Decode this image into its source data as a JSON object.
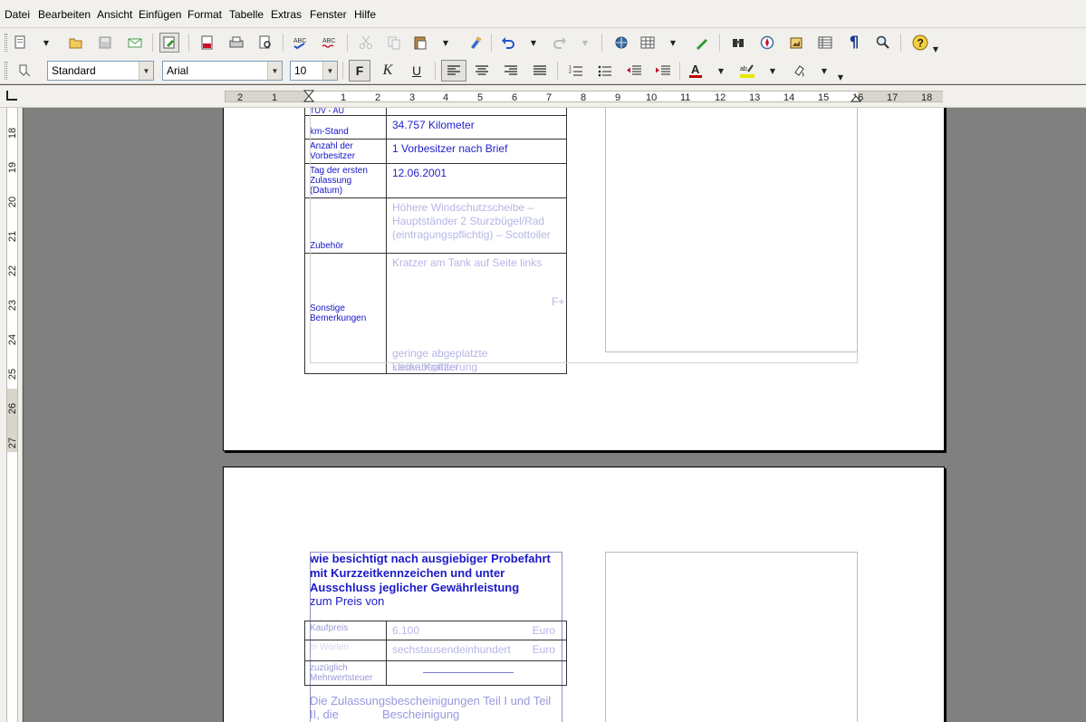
{
  "menu": {
    "items": [
      "Datei",
      "Bearbeiten",
      "Ansicht",
      "Einfügen",
      "Format",
      "Tabelle",
      "Extras",
      "Fenster",
      "Hilfe"
    ]
  },
  "toolbar1": {
    "icons": [
      "new-document-icon",
      "open-icon",
      "save-icon",
      "email-icon",
      "edit-mode-icon",
      "export-pdf-icon",
      "print-icon",
      "page-preview-icon",
      "spellcheck-icon",
      "autospellcheck-icon",
      "cut-icon",
      "copy-icon",
      "paste-icon",
      "format-paintbrush-icon",
      "undo-icon",
      "redo-icon",
      "hyperlink-icon",
      "table-icon",
      "draw-functions-icon",
      "find-replace-icon",
      "navigator-icon",
      "gallery-icon",
      "data-sources-icon",
      "formatting-marks-icon",
      "zoom-icon",
      "help-icon"
    ]
  },
  "toolbar2": {
    "paragraph_style": "Standard",
    "font_name": "Arial",
    "font_size": "10",
    "bold_label": "F",
    "italic_label": "K",
    "underline_label": "U",
    "font_color": "#c00000",
    "highlight_color": "#e8e800"
  },
  "ruler_h": {
    "labels": [
      "2",
      "1",
      "1",
      "2",
      "3",
      "4",
      "5",
      "6",
      "7",
      "8",
      "9",
      "10",
      "11",
      "12",
      "13",
      "14",
      "15",
      "16",
      "17",
      "18"
    ]
  },
  "ruler_v": {
    "labels": [
      "18",
      "19",
      "20",
      "21",
      "22",
      "23",
      "24",
      "25",
      "26",
      "27"
    ]
  },
  "page1": {
    "cut_row_label": "TÜV - AU",
    "rows": [
      {
        "label": "km-Stand",
        "value": "34.757 Kilometer"
      },
      {
        "label": "Anzahl der Vorbesitzer",
        "value": "1 Vorbesitzer nach Brief"
      },
      {
        "label": "Tag der ersten Zulassung (Datum)",
        "value": "12.06.2001"
      },
      {
        "label": "Zubehör",
        "value": "Höhere Windschutzscheibe – Hauptständer 2 Sturzbügel/Rad (eintragungspflichtig) – Scottoiler"
      },
      {
        "label": "Sonstige Bemerkungen",
        "value": "Kratzer am Tank auf Seite links"
      }
    ],
    "remark_fragments": [
      "F+",
      "geringe abgeplatzte Lackabsplitterung",
      "kleine Kratzer"
    ]
  },
  "page2": {
    "heading_lines": [
      "wie besichtigt nach ausgiebiger Probefahrt",
      "mit Kurzzeitkennzeichen und unter",
      "Ausschluss jeglicher Gewährleistung"
    ],
    "price_intro": "zum Preis von",
    "price_rows": [
      {
        "label": "Kaufpreis",
        "value": "6.100",
        "unit": "Euro"
      },
      {
        "label": "In Worten",
        "value": "sechstausendeinhundert",
        "unit": "Euro"
      },
      {
        "label": "zuzüglich Mehrwertsteuer",
        "value": ""
      }
    ],
    "footer_lines": [
      "Die Zulassungsbescheinigungen Teil I und Teil",
      "II, die"
    ],
    "footer_tail": "Bescheinigung"
  }
}
